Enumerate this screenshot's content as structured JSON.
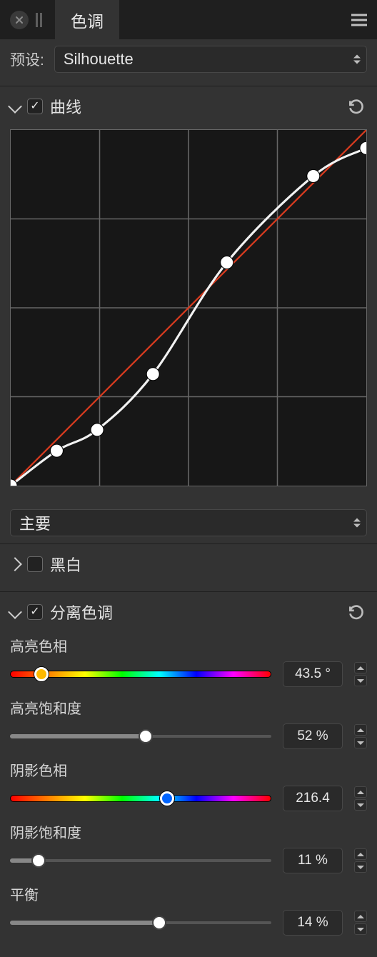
{
  "header": {
    "tab_title": "色调"
  },
  "preset": {
    "label": "预设:",
    "value": "Silhouette"
  },
  "sections": {
    "curves": {
      "title": "曲线",
      "enabled": true,
      "channel": "主要",
      "chart_data": {
        "type": "line",
        "xlim": [
          0,
          255
        ],
        "ylim": [
          0,
          255
        ],
        "baseline": [
          [
            0,
            0
          ],
          [
            255,
            255
          ]
        ],
        "points": [
          {
            "x": 0,
            "y": 0
          },
          {
            "x": 33,
            "y": 25
          },
          {
            "x": 62,
            "y": 40
          },
          {
            "x": 102,
            "y": 80
          },
          {
            "x": 155,
            "y": 160
          },
          {
            "x": 217,
            "y": 222
          },
          {
            "x": 255,
            "y": 242
          }
        ]
      }
    },
    "bw": {
      "title": "黑白",
      "enabled": false
    },
    "split": {
      "title": "分离色调",
      "enabled": true,
      "controls": {
        "highlight_hue": {
          "label": "高亮色相",
          "value": 43.5,
          "display": "43.5 °",
          "min": 0,
          "max": 360,
          "type": "hue"
        },
        "highlight_saturation": {
          "label": "高亮饱和度",
          "value": 52,
          "display": "52 %",
          "min": 0,
          "max": 100,
          "type": "plain"
        },
        "shadow_hue": {
          "label": "阴影色相",
          "value": 216.4,
          "display": "216.4",
          "min": 0,
          "max": 360,
          "type": "hue"
        },
        "shadow_saturation": {
          "label": "阴影饱和度",
          "value": 11,
          "display": "11 %",
          "min": 0,
          "max": 100,
          "type": "plain"
        },
        "balance": {
          "label": "平衡",
          "value": 14,
          "display": "14 %",
          "min": -100,
          "max": 100,
          "type": "plain"
        }
      }
    }
  }
}
